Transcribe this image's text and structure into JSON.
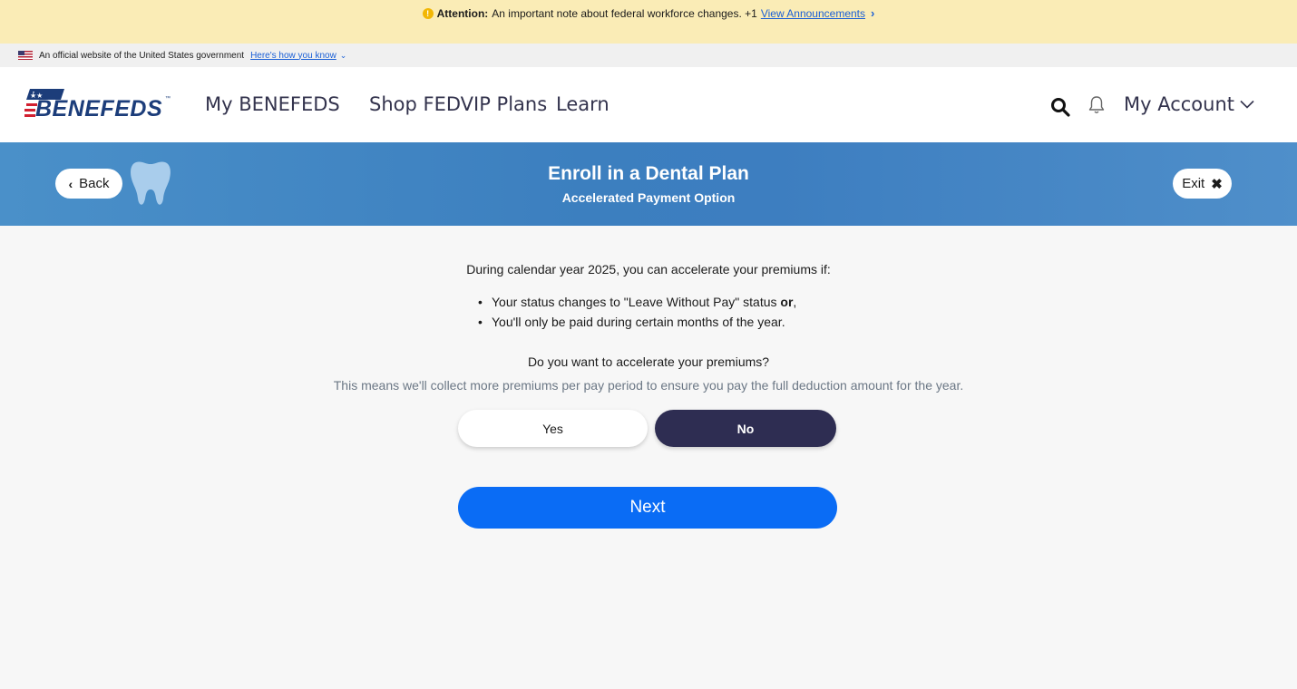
{
  "alert": {
    "icon": "info-warning-icon",
    "label": "Attention:",
    "message": "An important note about federal workforce changes. +1",
    "link": "View Announcements"
  },
  "gov_banner": {
    "text": "An official website of the United States government",
    "link": "Here's how you know"
  },
  "header": {
    "logo_text": "BENEFEDS",
    "logo_tm": "™",
    "nav": [
      "My BENEFEDS",
      "Shop FEDVIP Plans",
      "Learn"
    ],
    "account": "My Account"
  },
  "hero": {
    "back": "Back",
    "title": "Enroll in a Dental Plan",
    "subtitle": "Accelerated Payment Option",
    "exit": "Exit"
  },
  "content": {
    "intro": "During calendar year 2025, you can accelerate your premiums if:",
    "bullet_1_pre": "Your status changes to \"Leave Without Pay\" status ",
    "bullet_1_bold": "or",
    "bullet_1_post": ",",
    "bullet_2": "You'll only be paid during certain months of the year.",
    "question": "Do you want to accelerate your premiums?",
    "hint": "This means we'll collect more premiums per pay period to ensure you pay the full deduction amount for the year.",
    "yes": "Yes",
    "no": "No",
    "selected": "No",
    "next": "Next"
  },
  "colors": {
    "alert_bg": "#faecb6",
    "hero_blue": "#3c7fbf",
    "selected_dark": "#2e2d52",
    "primary_blue": "#0a6cf5"
  }
}
